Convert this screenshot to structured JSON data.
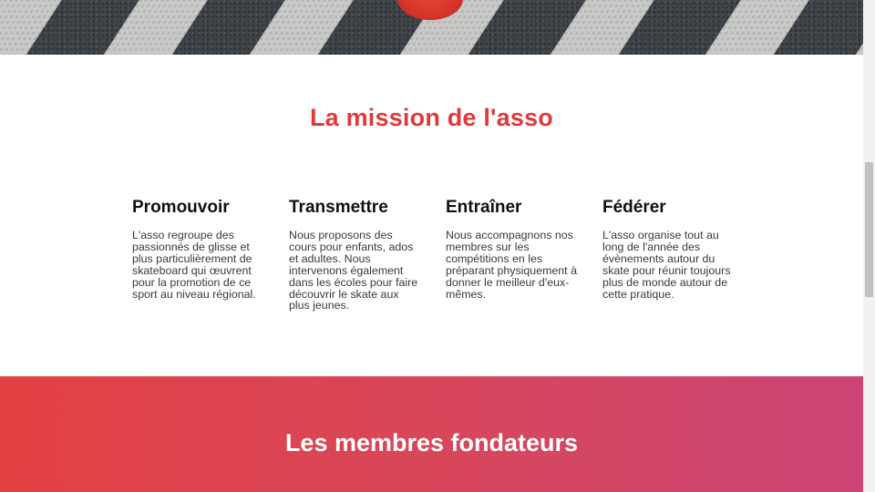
{
  "mission": {
    "title": "La mission de l'asso",
    "columns": [
      {
        "heading": "Promouvoir",
        "text": "L'asso regroupe des passionnés de glisse et plus particulièrement de skateboard qui œuvrent pour la promotion de ce sport au niveau régional."
      },
      {
        "heading": "Transmettre",
        "text": "Nous proposons des cours pour enfants, ados et adultes. Nous intervenons également dans les écoles pour faire découvrir le skate aux plus jeunes."
      },
      {
        "heading": "Entraîner",
        "text": "Nous accompagnons nos membres sur les compétitions en les préparant physiquement à donner le meilleur d'eux-mêmes."
      },
      {
        "heading": "Fédérer",
        "text": "L'asso organise tout au long de l'année des évènements autour du skate pour réunir toujours plus de monde autour de cette pratique."
      }
    ]
  },
  "founders": {
    "title": "Les membres fondateurs"
  },
  "colors": {
    "accent": "#e1393a",
    "band_start": "#e34243",
    "band_end": "#cc4576"
  }
}
